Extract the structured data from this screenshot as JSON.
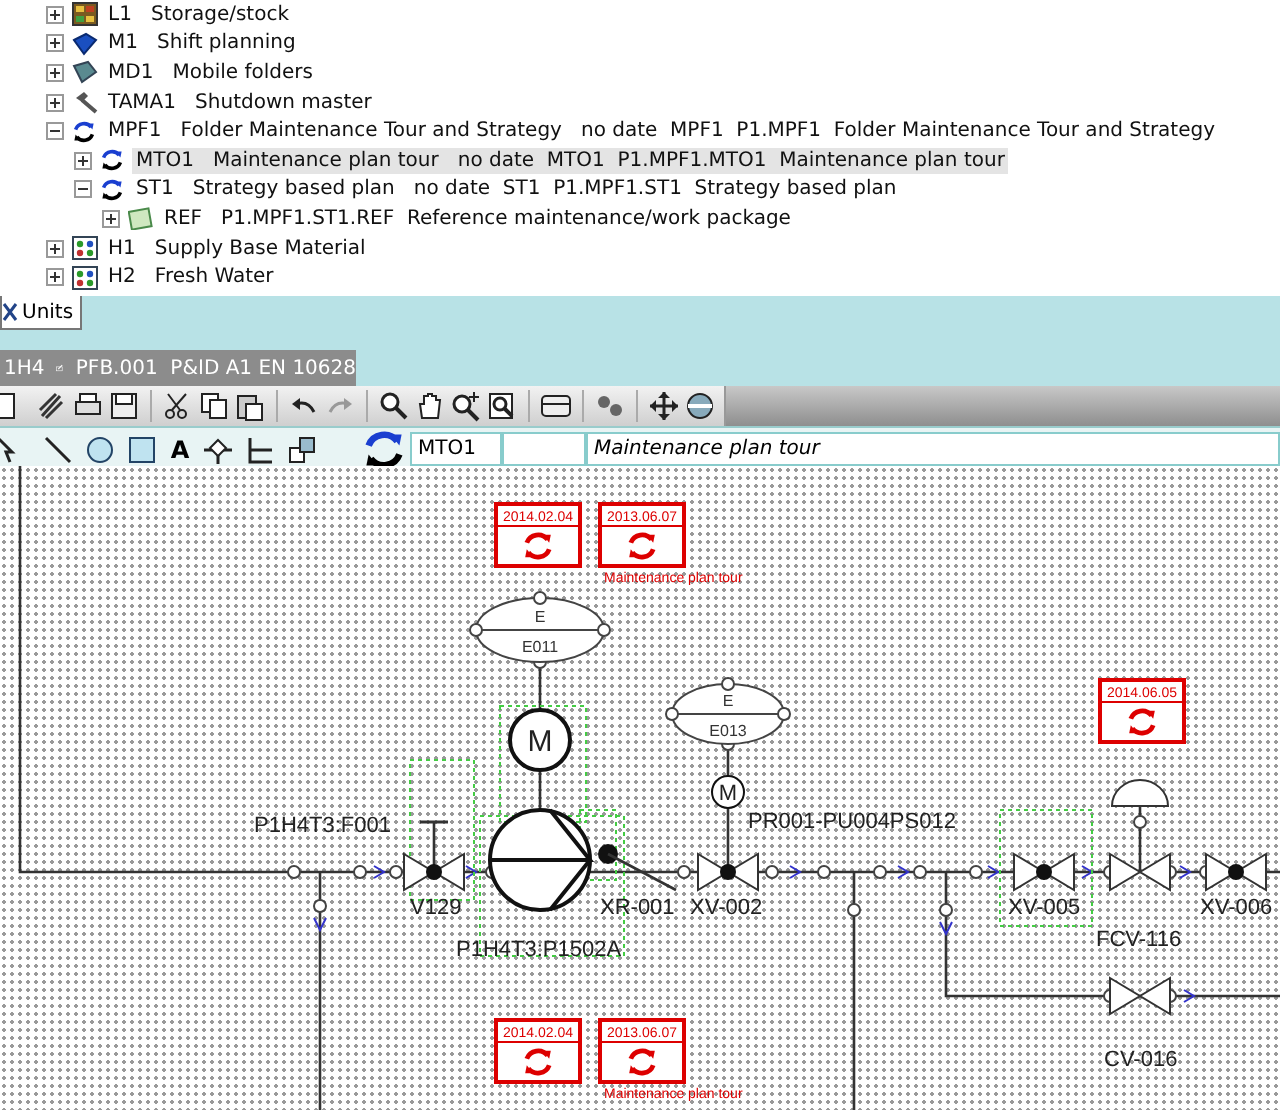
{
  "tree": [
    {
      "kind": "storage",
      "code": "L1",
      "text": "Storage/stock",
      "expanded": false,
      "selected": false
    },
    {
      "kind": "book",
      "code": "M1",
      "text": "Shift planning",
      "expanded": false,
      "selected": false
    },
    {
      "kind": "folders",
      "code": "MD1",
      "text": "Mobile folders",
      "expanded": false,
      "selected": false
    },
    {
      "kind": "hammer",
      "code": "TAMA1",
      "text": "Shutdown master",
      "expanded": false,
      "selected": false
    },
    {
      "kind": "cycle",
      "code": "MPF1",
      "text": "Folder Maintenance Tour and Strategy   no date  MPF1  P1.MPF1  Folder Maintenance Tour and Strategy",
      "expanded": true,
      "selected": false,
      "children": [
        {
          "kind": "cycle",
          "code": "MTO1",
          "text": "Maintenance plan tour   no date  MTO1  P1.MPF1.MTO1  Maintenance plan tour",
          "expanded": false,
          "selected": true
        },
        {
          "kind": "cycle",
          "code": "ST1",
          "text": "Strategy based plan   no date  ST1  P1.MPF1.ST1  Strategy based plan",
          "expanded": true,
          "selected": false,
          "children": [
            {
              "kind": "package",
              "code": "REF",
              "text": "P1.MPF1.ST1.REF  Reference maintenance/work package",
              "expanded": false,
              "selected": false
            }
          ]
        }
      ]
    },
    {
      "kind": "material",
      "code": "H1",
      "text": "Supply Base Material",
      "expanded": false,
      "selected": false
    },
    {
      "kind": "material",
      "code": "H2",
      "text": "Fresh Water",
      "expanded": false,
      "selected": false
    }
  ],
  "units_tab": {
    "label": "Units"
  },
  "document_tab": {
    "prefix": "1H4",
    "title": "PFB.001  P&ID A1 EN 10628"
  },
  "tool_palette": {
    "text_tool": "A"
  },
  "object_bar": {
    "code": "MTO1",
    "name": "Maintenance plan tour"
  },
  "diagram": {
    "maintenance_markers": [
      {
        "date": "2014.02.04"
      },
      {
        "date": "2013.06.07",
        "caption": "Maintenance plan tour"
      },
      {
        "date": "2014.06.05"
      },
      {
        "date": "2014.02.04"
      },
      {
        "date": "2013.06.07",
        "caption": "Maintenance plan tour"
      }
    ],
    "electrical_units": [
      {
        "letter": "E",
        "tag": "E011"
      },
      {
        "letter": "E",
        "tag": "E013"
      }
    ],
    "motors": [
      {
        "letter": "M"
      },
      {
        "letter": "M"
      }
    ],
    "tags": [
      "P1H4T3:F001",
      "V129",
      "P1H4T3:P1502A",
      "XR-001",
      "XV-002",
      "PR001-PU004PS012",
      "XV-005",
      "XV-006",
      "FCV-116",
      "CV-016"
    ]
  }
}
